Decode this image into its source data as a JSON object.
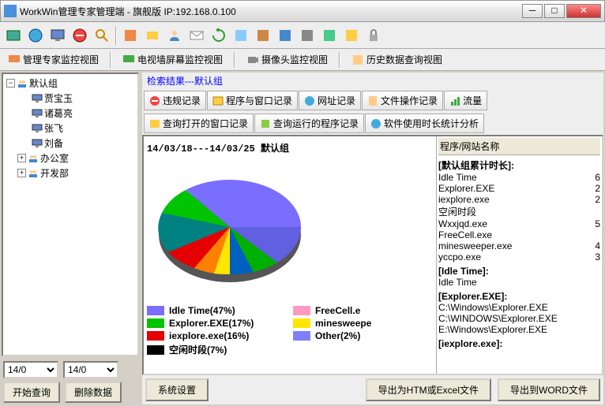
{
  "window": {
    "title": "WorkWin管理专家管理端 - 旗舰版 IP:192.168.0.100"
  },
  "viewtabs": {
    "t1": "管理专家监控视图",
    "t2": "电视墙屏幕监控视图",
    "t3": "摄像头监控视图",
    "t4": "历史数据查询视图"
  },
  "tree": {
    "root": "默认组",
    "u1": "贾宝玉",
    "u2": "诸葛亮",
    "u3": "张飞",
    "u4": "刘备",
    "g1": "办公室",
    "g2": "开发部"
  },
  "search_header": "检索结果---默认组",
  "tabs": {
    "t1": "违规记录",
    "t2": "程序与窗口记录",
    "t3": "网址记录",
    "t4": "文件操作记录",
    "t5": "流量",
    "s1": "查询打开的窗口记录",
    "s2": "查询运行的程序记录",
    "s3": "软件使用时长统计分析"
  },
  "chart_data": {
    "type": "pie",
    "title": "14/03/18---14/03/25  默认组",
    "series": [
      {
        "name": "Idle Time",
        "pct": 47,
        "color": "#7a6eff"
      },
      {
        "name": "Explorer.EXE",
        "pct": 17,
        "color": "#00c400"
      },
      {
        "name": "iexplore.exe",
        "pct": 16,
        "color": "#e40000"
      },
      {
        "name": "空闲时段",
        "pct": 7,
        "color": "#000000"
      },
      {
        "name": "FreeCell.exe",
        "pct": 0,
        "color": "#ff99c2",
        "label": "FreeCell.e"
      },
      {
        "name": "minesweeper.exe",
        "pct": 0,
        "color": "#ffe600",
        "label": "minesweepe"
      },
      {
        "name": "Other",
        "pct": 2,
        "color": "#8080ff"
      }
    ],
    "legend": {
      "l1": "Idle Time(47%)",
      "l2": "Explorer.EXE(17%)",
      "l3": "iexplore.exe(16%)",
      "l4": "空闲时段(7%)",
      "l5": "FreeCell.e",
      "l6": "minesweepe",
      "l7": "Other(2%)"
    }
  },
  "detail": {
    "header": "程序/网站名称",
    "group0": "[默认组累计时长]:",
    "r1n": "Idle Time",
    "r1v": "6",
    "r2n": "Explorer.EXE",
    "r2v": "2",
    "r3n": "iexplore.exe",
    "r3v": "2",
    "r4n": "空闲时段",
    "r4v": "",
    "r5n": "Wxxjqd.exe",
    "r5v": "5",
    "r6n": "FreeCell.exe",
    "r6v": "",
    "r7n": "minesweeper.exe",
    "r7v": "4",
    "r8n": "yccpo.exe",
    "r8v": "3",
    "group1": "[Idle Time]:",
    "g1r1": "Idle Time",
    "group2": "[Explorer.EXE]:",
    "g2r1": "C:\\Windows\\Explorer.EXE",
    "g2r2": "C:\\WINDOWS\\Explorer.EXE",
    "g2r3": "E:\\Windows\\Explorer.EXE",
    "group3": "[iexplore.exe]:"
  },
  "dates": {
    "from": "14/0",
    "to": "14/0"
  },
  "buttons": {
    "query": "开始查询",
    "delete": "删除数据",
    "settings": "系统设置",
    "export_excel": "导出为HTM或Excel文件",
    "export_word": "导出到WORD文件"
  }
}
